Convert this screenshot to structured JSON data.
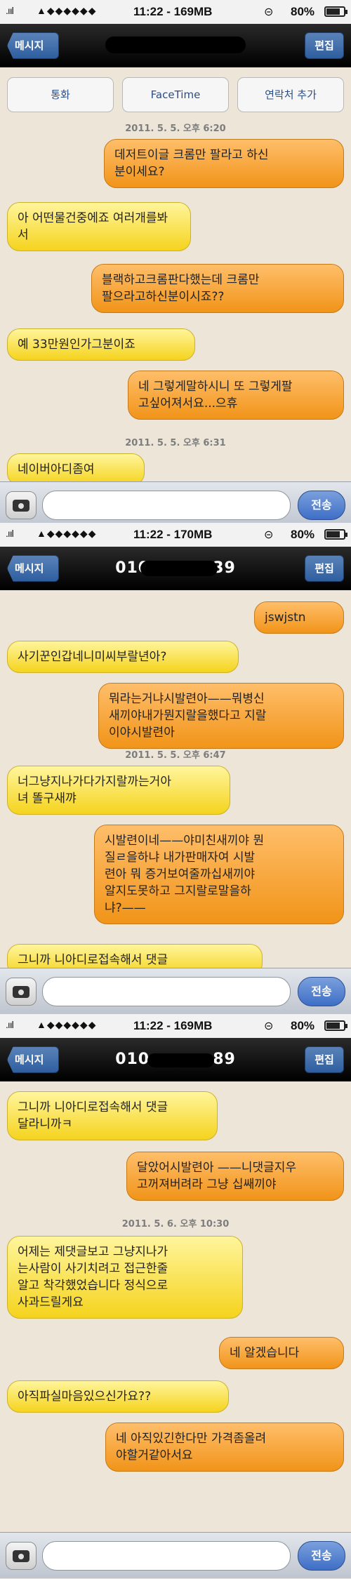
{
  "screens": [
    {
      "status": {
        "signal": ".ııl",
        "apps": "▲◆◆◆◆◆◆",
        "time": "11:22 - 169MB",
        "lock": "⊝",
        "battery_text": "80%",
        "battery_level": 0.8
      },
      "nav": {
        "back_label": "메시지",
        "title": "",
        "edit_label": "편집"
      },
      "actions": [
        "통화",
        "FaceTime",
        "연락처 추가"
      ],
      "timestamps": [
        "2011. 5. 5. 오후 6:20",
        "2011. 5. 5. 오후 6:31"
      ],
      "messages": [
        {
          "dir": "out",
          "text": "데저트이글 크롬만 팔라고 하신\n분이세요?"
        },
        {
          "dir": "in",
          "text": "아 어떤물건중에죠 여러개를봐\n서"
        },
        {
          "dir": "out",
          "text": "블랙하고크롬판다했는데 크롬만\n팔으라고하신분이시죠??"
        },
        {
          "dir": "in",
          "text": "예 33만원인가그분이죠"
        },
        {
          "dir": "out",
          "text": "네 그렇게말하시니 또 그렇게팔\n고싶어져서요...으휴"
        },
        {
          "dir": "in",
          "text": "네이버아디좀여"
        }
      ],
      "input": {
        "placeholder": "",
        "send_label": "전송"
      }
    },
    {
      "status": {
        "signal": ".ııl",
        "apps": "▲◆◆◆◆◆◆",
        "time": "11:22 - 170MB",
        "lock": "⊝",
        "battery_text": "80%",
        "battery_level": 0.8
      },
      "nav": {
        "back_label": "메시지",
        "title": "010 · · · · ·39",
        "edit_label": "편집"
      },
      "timestamps": [
        "2011. 5. 5. 오후 6:47"
      ],
      "messages": [
        {
          "dir": "out",
          "text": "jswjstn"
        },
        {
          "dir": "in",
          "text": "사기꾼인갑네니미씨부랄년아?"
        },
        {
          "dir": "out",
          "text": "뭐라는거냐시발련아——뭐병신\n새끼야내가뭔지랄을했다고 지랄\n이야시발련아"
        },
        {
          "dir": "in",
          "text": "너그냥지나가다가지랄까는거아\n녀 똘구새꺄"
        },
        {
          "dir": "out",
          "text": "시발련이네——야미친새끼야 뭔\n질ㄹ을하냐 내가판매자여 시발\n련아 뭐 증거보여줄까십새끼야\n알지도못하고 그지랄로말을하\n냐?——"
        },
        {
          "dir": "in",
          "text": "그니까 니아디로접속해서 댓글"
        }
      ],
      "input": {
        "placeholder": "",
        "send_label": "전송"
      }
    },
    {
      "status": {
        "signal": ".ııl",
        "apps": "▲◆◆◆◆◆◆",
        "time": "11:22 - 169MB",
        "lock": "⊝",
        "battery_text": "80%",
        "battery_level": 0.8
      },
      "nav": {
        "back_label": "메시지",
        "title": "010 · · · · ·89",
        "edit_label": "편집"
      },
      "timestamps": [
        "2011. 5. 6. 오후 10:30"
      ],
      "messages": [
        {
          "dir": "in",
          "text": "그니까 니아디로접속해서 댓글\n달라니까ㅋ"
        },
        {
          "dir": "out",
          "text": "달았어시발련아 ——니댓글지우\n고꺼져버려라 그냥 십쌔끼야"
        },
        {
          "dir": "in",
          "text": "어제는 제댓글보고 그냥지나가\n는사람이 사기치려고 접근한줄\n알고 착각했었습니다 정식으로\n사과드릴게요"
        },
        {
          "dir": "out",
          "text": "네 알겠습니다"
        },
        {
          "dir": "in",
          "text": "아직파실마음있으신가요??"
        },
        {
          "dir": "out",
          "text": "네 아직있긴한다만 가격좀올려\n야할거같아서요"
        }
      ],
      "input": {
        "placeholder": "",
        "send_label": "전송"
      }
    }
  ]
}
